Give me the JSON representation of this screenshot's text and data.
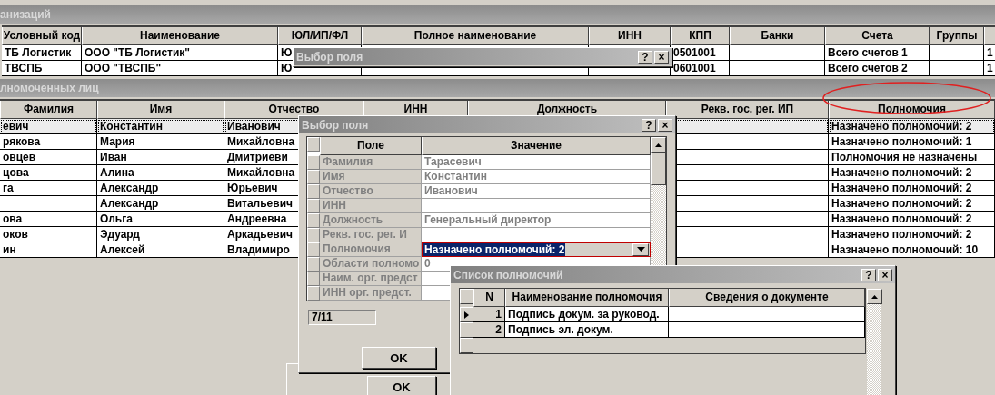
{
  "organizations": {
    "title": "анизаций",
    "columns": [
      "Условный код",
      "Наименование",
      "ЮЛ/ИП/ФЛ",
      "Полное наименование",
      "ИНН",
      "КПП",
      "Банки",
      "Счета",
      "Группы",
      null
    ],
    "rows": [
      [
        "ТБ Логистик",
        "ООО \"ТБ Логистик\"",
        "Ю",
        null,
        null,
        "0501001",
        null,
        "Всего счетов 1",
        null,
        "1"
      ],
      [
        "ТВСПБ",
        "ООО \"ТВСПБ\"",
        "Ю",
        null,
        null,
        "0601001",
        null,
        "Всего счетов 2",
        null,
        "1"
      ]
    ]
  },
  "persons": {
    "title": "лномоченных лиц",
    "columns": [
      "Фамилия",
      "Имя",
      "Отчество",
      "ИНН",
      "Должность",
      "Рекв. гос. рег. ИП",
      "Полномочия"
    ],
    "rows": [
      {
        "selected": true,
        "cells": [
          "евич",
          "Константин",
          "Иванович",
          null,
          null,
          null,
          "Назначено полномочий: 2"
        ]
      },
      {
        "selected": false,
        "cells": [
          "рякова",
          "Мария",
          "Михайловна",
          null,
          null,
          null,
          "Назначено полномочий: 1"
        ]
      },
      {
        "selected": false,
        "cells": [
          "овцев",
          "Иван",
          "Дмитриеви",
          null,
          null,
          null,
          "Полномочия не назначены"
        ]
      },
      {
        "selected": false,
        "cells": [
          "цова",
          "Алина",
          "Михайловна",
          null,
          null,
          null,
          "Назначено полномочий: 2"
        ]
      },
      {
        "selected": false,
        "cells": [
          "га",
          "Александр",
          "Юрьевич",
          null,
          null,
          null,
          "Назначено полномочий: 2"
        ]
      },
      {
        "selected": false,
        "cells": [
          null,
          "Александр",
          "Витальевич",
          null,
          null,
          null,
          "Назначено полномочий: 2"
        ]
      },
      {
        "selected": false,
        "cells": [
          "ова",
          "Ольга",
          "Андреевна",
          null,
          null,
          null,
          "Назначено полномочий: 2"
        ]
      },
      {
        "selected": false,
        "cells": [
          "оков",
          "Эдуард",
          "Аркадьевич",
          null,
          null,
          null,
          "Назначено полномочий: 2"
        ]
      },
      {
        "selected": false,
        "cells": [
          "ин",
          "Алексей",
          "Владимиро",
          null,
          null,
          null,
          "Назначено полномочий: 10"
        ]
      }
    ]
  },
  "back_dialog": {
    "title": "Выбор поля",
    "help": "?",
    "close": "×",
    "ok": "OK"
  },
  "field_dialog": {
    "title": "Выбор поля",
    "help": "?",
    "close": "×",
    "columns": [
      "Поле",
      "Значение"
    ],
    "rows": [
      {
        "field": "Фамилия",
        "value": "Тарасевич",
        "selected": false
      },
      {
        "field": "Имя",
        "value": "Константин",
        "selected": false
      },
      {
        "field": "Отчество",
        "value": "Иванович",
        "selected": false
      },
      {
        "field": "ИНН",
        "selected": false
      },
      {
        "field": "Должность",
        "value": "Генеральный директор",
        "selected": false
      },
      {
        "field": "Рекв. гос. рег. И",
        "selected": false
      },
      {
        "field": "Полномочия",
        "value": "Назначено полномочий: 2",
        "selected": true
      },
      {
        "field": "Области полномо",
        "value": "0",
        "selected": false
      },
      {
        "field": "Наим. орг. предст",
        "selected": false
      },
      {
        "field": "ИНН орг. предст.",
        "selected": false
      }
    ],
    "counter": "7/11",
    "ok": "OK"
  },
  "permissions_dialog": {
    "title": "Список полномочий",
    "help": "?",
    "close": "×",
    "columns": [
      "N",
      "Наименование полномочия",
      "Сведения о документе"
    ],
    "rows": [
      {
        "n": "1",
        "name": "Подпись докум. за руковод.",
        "selected": true
      },
      {
        "n": "2",
        "name": "Подпись эл. докум.",
        "selected": false
      }
    ]
  }
}
